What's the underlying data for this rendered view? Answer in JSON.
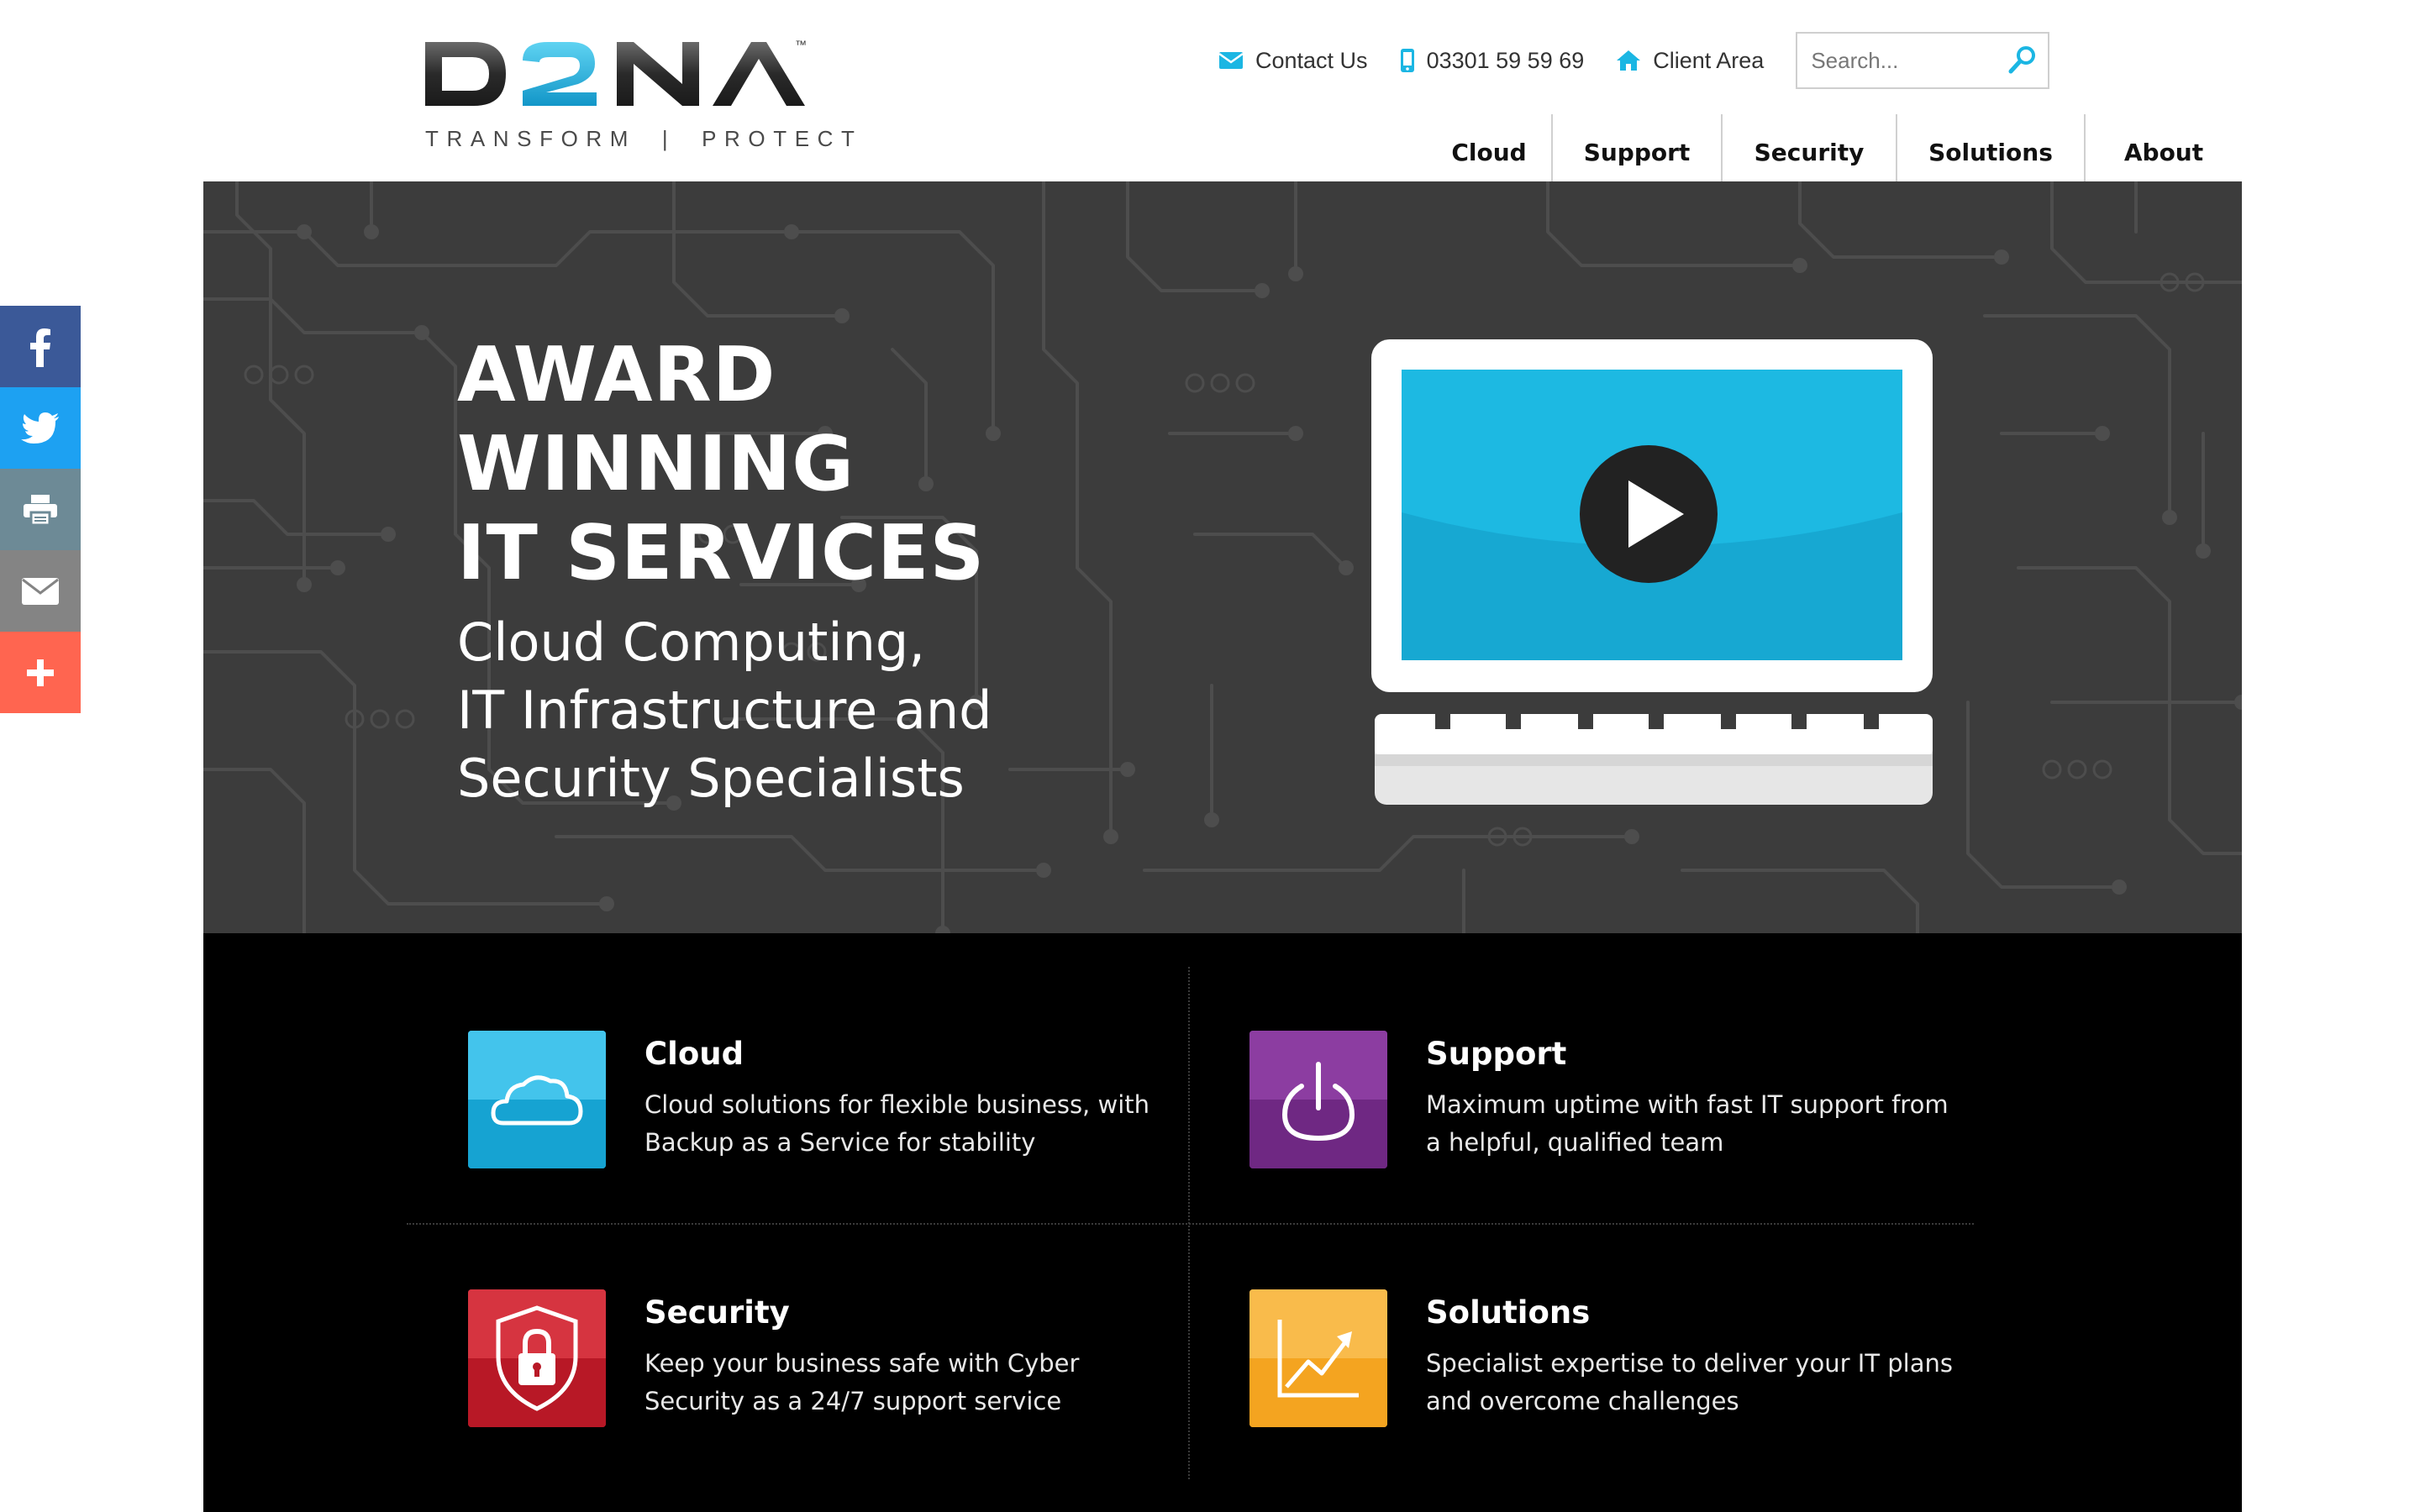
{
  "brand": {
    "name": "D2NA",
    "tagline_left": "TRANSFORM",
    "tagline_sep": "|",
    "tagline_right": "PROTECT",
    "trademark": "™",
    "accent": "#1bb6e3",
    "dark": "#2b2b2b"
  },
  "utility": {
    "contact": {
      "label": "Contact Us",
      "icon": "envelope-icon"
    },
    "phone": {
      "label": "03301 59 59 69",
      "icon": "mobile-phone-icon"
    },
    "client": {
      "label": "Client Area",
      "icon": "home-icon"
    },
    "search": {
      "placeholder": "Search...",
      "icon": "search-icon"
    }
  },
  "nav": [
    {
      "label": "Cloud"
    },
    {
      "label": "Support"
    },
    {
      "label": "Security"
    },
    {
      "label": "Solutions"
    },
    {
      "label": "About"
    }
  ],
  "share": [
    {
      "name": "facebook-icon",
      "color": "#3b5998"
    },
    {
      "name": "twitter-icon",
      "color": "#1da1f2"
    },
    {
      "name": "print-icon",
      "color": "#6d8a96"
    },
    {
      "name": "email-icon",
      "color": "#848484"
    },
    {
      "name": "plus-icon",
      "color": "#ff6550"
    }
  ],
  "hero": {
    "title_lines": [
      "AWARD",
      "WINNING",
      "IT SERVICES"
    ],
    "subtitle_lines": [
      "Cloud Computing,",
      "IT Infrastructure and",
      "Security Specialists"
    ],
    "video_icon": "play-button-icon",
    "screen_color": "#1db9e2"
  },
  "services": [
    {
      "title": "Cloud",
      "desc_lines": [
        "Cloud solutions for flexible business, with",
        "Backup as a Service for stability"
      ],
      "icon": "cloud-icon",
      "color": "#1fb3e0"
    },
    {
      "title": "Support",
      "desc_lines": [
        "Maximum uptime with fast IT support from",
        "a helpful, qualified team"
      ],
      "icon": "power-icon",
      "color": "#7b2f8e"
    },
    {
      "title": "Security",
      "desc_lines": [
        "Keep your business safe with Cyber",
        "Security as a 24/7 support service"
      ],
      "icon": "shield-lock-icon",
      "color": "#c8202f"
    },
    {
      "title": "Solutions",
      "desc_lines": [
        "Specialist expertise to deliver your IT plans",
        "and overcome challenges"
      ],
      "icon": "chart-growth-icon",
      "color": "#f7ad30"
    }
  ]
}
